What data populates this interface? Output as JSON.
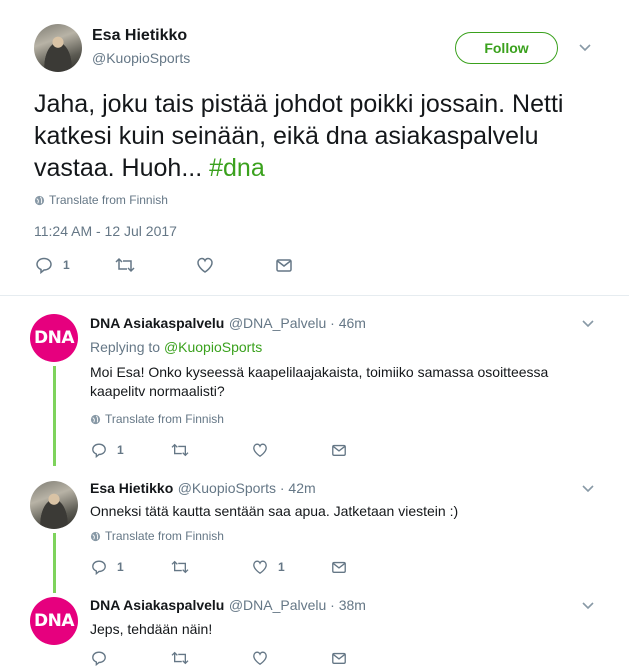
{
  "main_tweet": {
    "author_name": "Esa Hietikko",
    "author_handle": "@KuopioSports",
    "follow_label": "Follow",
    "text_prefix": "Jaha, joku tais pistää johdot poikki jossain. Netti katkesi kuin seinään, eikä dna asiakaspalvelu vastaa. Huoh... ",
    "hashtag": "#dna",
    "translate_label": "Translate from Finnish",
    "timestamp": "11:24 AM - 12 Jul 2017",
    "reply_count": "1"
  },
  "replies": [
    {
      "author_name": "DNA Asiakaspalvelu",
      "author_handle": "@DNA_Palvelu · 46m",
      "avatar_text": "DNA",
      "replying_prefix": "Replying to ",
      "replying_handle": "@KuopioSports",
      "text": "Moi Esa! Onko kyseessä kaapelilaajakaista, toimiiko samassa osoitteessa kaapelitv normaalisti?",
      "translate_label": "Translate from Finnish",
      "reply_count": "1",
      "like_count": ""
    },
    {
      "author_name": "Esa Hietikko",
      "author_handle": "@KuopioSports · 42m",
      "text": "Onneksi tätä kautta sentään saa apua. Jatketaan viestein :)",
      "translate_label": "Translate from Finnish",
      "reply_count": "1",
      "like_count": "1"
    },
    {
      "author_name": "DNA Asiakaspalvelu",
      "author_handle": "@DNA_Palvelu · 38m",
      "avatar_text": "DNA",
      "text": "Jeps, tehdään näin!"
    }
  ],
  "colors": {
    "accent_green": "#3aa11d",
    "dna_pink": "#e6007e",
    "thread_line": "#7ed35c",
    "muted": "#657786"
  },
  "icons": [
    "reply-icon",
    "retweet-icon",
    "like-icon",
    "dm-icon",
    "globe-icon",
    "chevron-down-icon"
  ]
}
